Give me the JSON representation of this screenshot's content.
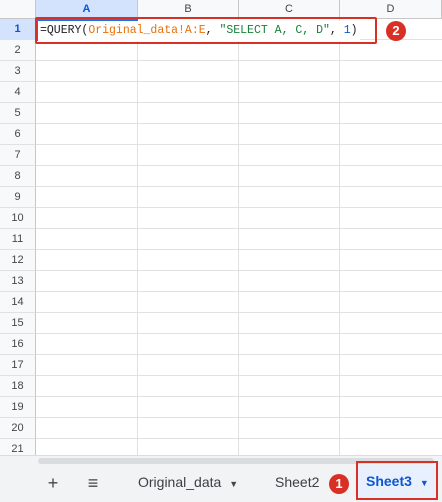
{
  "columns": [
    "A",
    "B",
    "C",
    "D"
  ],
  "rows": [
    "1",
    "2",
    "3",
    "4",
    "5",
    "6",
    "7",
    "8",
    "9",
    "10",
    "11",
    "12",
    "13",
    "14",
    "15",
    "16",
    "17",
    "18",
    "19",
    "20",
    "21"
  ],
  "formula": {
    "prefix": "=QUERY(",
    "range": "Original_data!A:E",
    "sep1": ", ",
    "query": "\"SELECT A, C, D\"",
    "sep2": ", ",
    "header": "1",
    "suffix": ")"
  },
  "badges": {
    "formula_step": "2",
    "tab_step": "1"
  },
  "bottom_bar": {
    "add_label": "+",
    "menu_label": "≡",
    "tabs": [
      {
        "label": "Original_data",
        "caret": "▼"
      },
      {
        "label": "Sheet2",
        "caret": "▼"
      },
      {
        "label": "Sheet3",
        "caret": "▼"
      }
    ]
  },
  "colors": {
    "highlight": "#d93025",
    "selection": "#1a73e8",
    "range_text": "#e8710a",
    "string_text": "#188038",
    "number_text": "#1155cc"
  }
}
